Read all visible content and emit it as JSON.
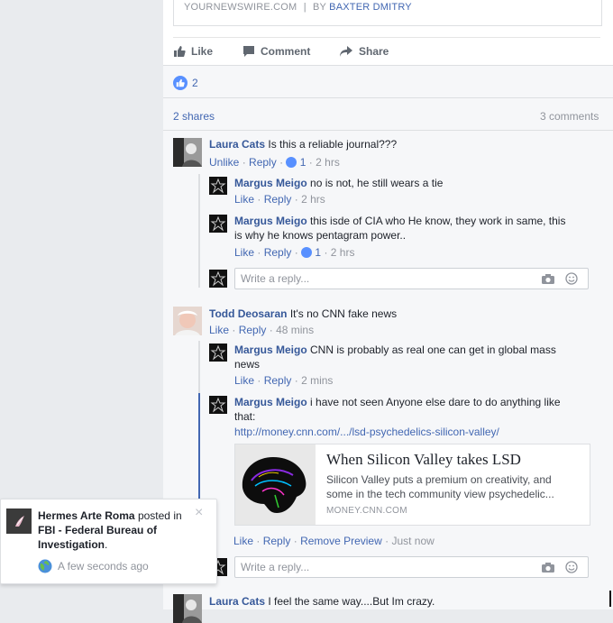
{
  "post": {
    "source": "YOURNEWSWIRE.COM",
    "by_prefix": "BY",
    "author": "BAXTER DMITRY",
    "actions": {
      "like": "Like",
      "comment": "Comment",
      "share": "Share"
    },
    "like_count": "2",
    "shares": "2 shares",
    "comments": "3 comments"
  },
  "comments": [
    {
      "name": "Laura Cats",
      "text": "Is this a reliable journal???",
      "actions": {
        "unlike": "Unlike",
        "reply": "Reply",
        "likes": "1",
        "time": "2 hrs"
      },
      "replies": [
        {
          "name": "Margus Meigo",
          "text": "no is not, he still wears a tie",
          "like": "Like",
          "reply": "Reply",
          "time": "2 hrs"
        },
        {
          "name": "Margus Meigo",
          "text": "this isde of CIA who He know, they work in same, this",
          "text2": "is why he knows pentagram power..",
          "like": "Like",
          "reply": "Reply",
          "likes": "1",
          "time": "2 hrs"
        }
      ]
    },
    {
      "name": "Todd Deosaran",
      "text": "It's no CNN fake news",
      "actions": {
        "like": "Like",
        "reply": "Reply",
        "time": "48 mins"
      },
      "replies": [
        {
          "name": "Margus Meigo",
          "text": "CNN is probably as real one can get in global mass",
          "text2": "news",
          "like": "Like",
          "reply": "Reply",
          "time": "2 mins"
        },
        {
          "name": "Margus Meigo",
          "text": "i have not seen Anyone else dare to do anything like",
          "text2": "that:",
          "url": "http://money.cnn.com/.../lsd-psychedelics-silicon-valley/",
          "preview": {
            "title": "When Silicon Valley takes LSD",
            "desc1": "Silicon Valley puts a premium on creativity, and",
            "desc2": "some in the tech community view psychedelic...",
            "domain": "MONEY.CNN.COM"
          },
          "like": "Like",
          "reply": "Reply",
          "remove": "Remove Preview",
          "time": "Just now"
        }
      ]
    },
    {
      "name": "Laura Cats",
      "text": "I feel the same way....But Im crazy."
    }
  ],
  "reply_placeholder": "Write a reply...",
  "notification": {
    "actor": "Hermes Arte Roma",
    "verb": "posted in",
    "target": "FBI - Federal Bureau of",
    "target2": "Investigation",
    "dot": ".",
    "time": "A few seconds ago",
    "close": "×"
  },
  "colors": {
    "link": "#4267b2",
    "name": "#365899",
    "bg": "#e9ebee",
    "line_active": "#4267b2"
  }
}
